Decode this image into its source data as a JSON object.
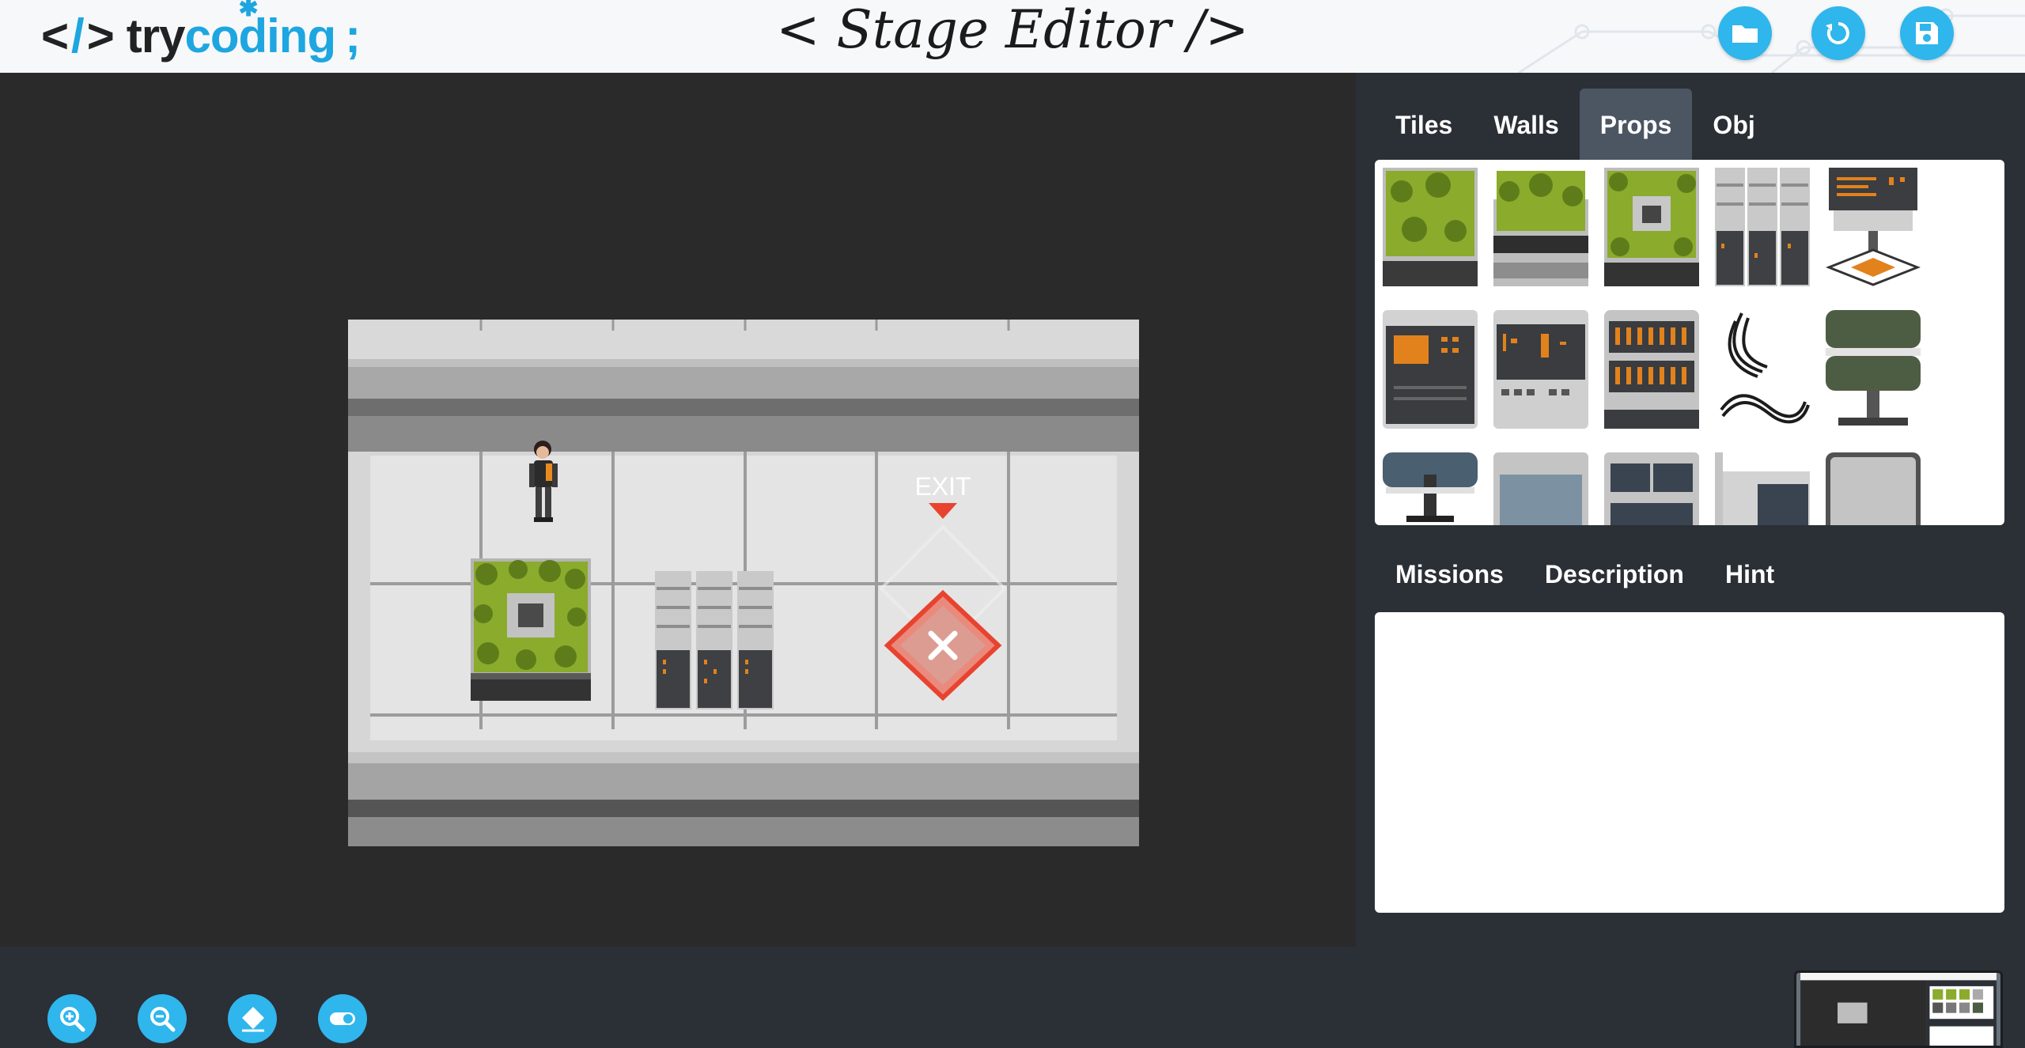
{
  "header": {
    "logo": {
      "bracket_left": "<",
      "slash": "/",
      "bracket_right": ">",
      "text_try": "try",
      "text_coding": "coding",
      "semicolon": ";"
    },
    "title": "< Stage Editor />",
    "buttons": [
      {
        "name": "open-folder-button",
        "icon": "folder-icon"
      },
      {
        "name": "reset-button",
        "icon": "refresh-icon"
      },
      {
        "name": "save-button",
        "icon": "floppy-disk-icon"
      }
    ]
  },
  "stage": {
    "exit_label": "EXIT"
  },
  "palette": {
    "tabs": [
      {
        "label": "Tiles",
        "active": false
      },
      {
        "label": "Walls",
        "active": false
      },
      {
        "label": "Props",
        "active": true
      },
      {
        "label": "Obj",
        "active": false
      }
    ],
    "items": [
      "plant-box-prop",
      "plant-box-short-prop",
      "plant-ring-prop",
      "server-rack-prop",
      "terminal-pad-prop",
      "console-prop",
      "control-panel-prop",
      "cabinet-prop",
      "cables-prop",
      "green-stool-prop",
      "blue-stool-prop",
      "screen-panel-prop",
      "double-screen-prop",
      "doorway-prop",
      "monitor-prop"
    ]
  },
  "info": {
    "tabs": [
      {
        "label": "Missions"
      },
      {
        "label": "Description"
      },
      {
        "label": "Hint"
      }
    ],
    "content": ""
  },
  "toolbar": {
    "tools": [
      {
        "name": "zoom-in-button",
        "icon": "zoom-in-icon"
      },
      {
        "name": "zoom-out-button",
        "icon": "zoom-out-icon"
      },
      {
        "name": "eraser-button",
        "icon": "eraser-icon"
      },
      {
        "name": "toggle-button",
        "icon": "toggle-icon"
      }
    ]
  },
  "colors": {
    "accent": "#2fb6ec",
    "panel_bg": "#2b2f36",
    "canvas_bg": "#2a2a2a",
    "active_tab": "#4c5663",
    "exit_red": "#e8432f",
    "plant_green": "#7a9a2a"
  }
}
